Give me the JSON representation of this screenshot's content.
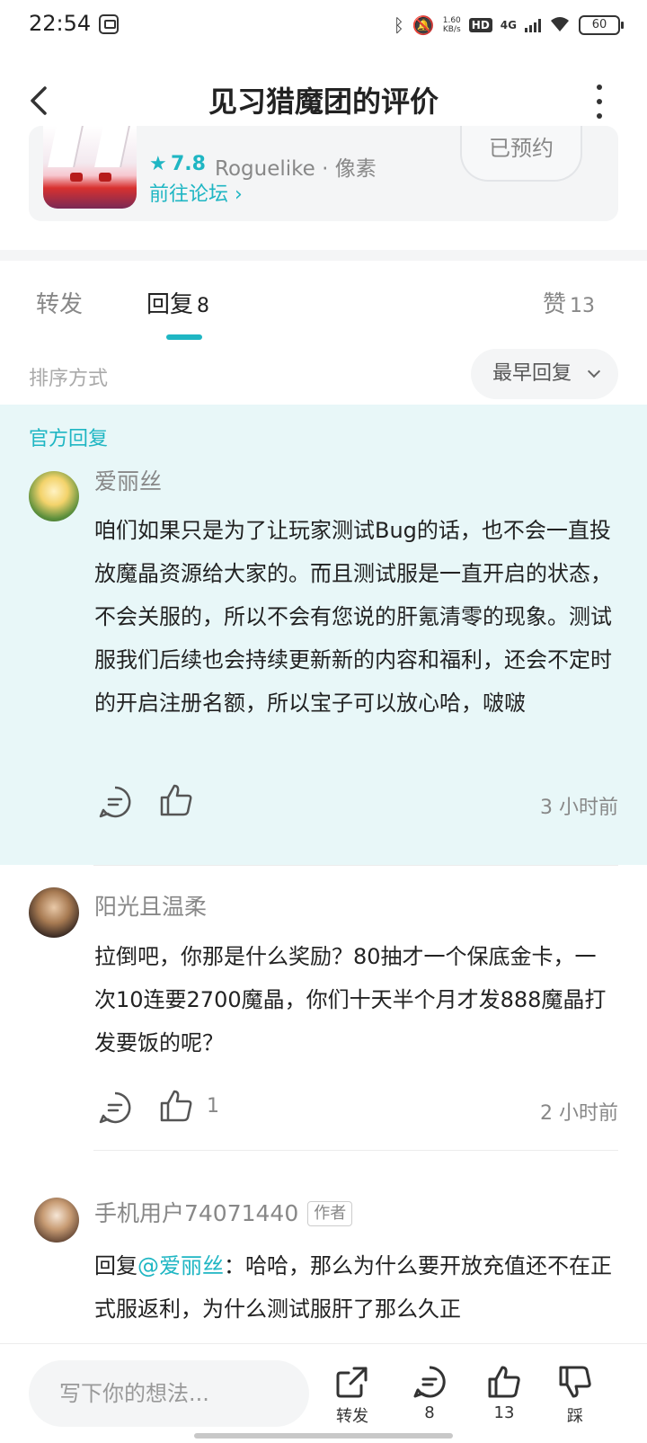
{
  "status_bar": {
    "time": "22:54",
    "speed_top": "1.60",
    "speed_bottom": "KB/s",
    "hd": "HD",
    "network": "4G",
    "battery": "60"
  },
  "header": {
    "title": "见习猎魔团的评价"
  },
  "game_card": {
    "rating": "7.8",
    "tags": "Roguelike · 像素",
    "forum_link": "前往论坛 ›",
    "reserve_label": "已预约"
  },
  "tabs": [
    {
      "label": "转发",
      "count": ""
    },
    {
      "label": "回复",
      "count": "8"
    },
    {
      "label": "赞",
      "count": "13"
    }
  ],
  "sort": {
    "label": "排序方式",
    "selected": "最早回复"
  },
  "official": {
    "label": "官方回复"
  },
  "comments": [
    {
      "username": "爱丽丝",
      "text": "咱们如果只是为了让玩家测试Bug的话，也不会一直投放魔晶资源给大家的。而且测试服是一直开启的状态，不会关服的，所以不会有您说的肝氪清零的现象。测试服我们后续也会持续更新新的内容和福利，还会不定时的开启注册名额，所以宝子可以放心哈，啵啵",
      "likes": "",
      "time": "3 小时前"
    },
    {
      "username": "阳光且温柔",
      "text": "拉倒吧，你那是什么奖励？80抽才一个保底金卡，一次10连要2700魔晶，你们十天半个月才发888魔晶打发要饭的呢？",
      "likes": "1",
      "time": "2 小时前"
    },
    {
      "username": "手机用户74071440",
      "author_tag": "作者",
      "reply_prefix": "回复",
      "mention": "@爱丽丝",
      "text": "：哈哈，那么为什么要开放充值还不在正式服返利，为什么测试服肝了那么久正"
    }
  ],
  "bottom_bar": {
    "input_placeholder": "写下你的想法...",
    "share_label": "转发",
    "comment_count": "8",
    "like_count": "13",
    "dislike_label": "踩"
  },
  "colors": {
    "accent": "#1fb6c3",
    "official_bg": "#e8f7f8"
  }
}
